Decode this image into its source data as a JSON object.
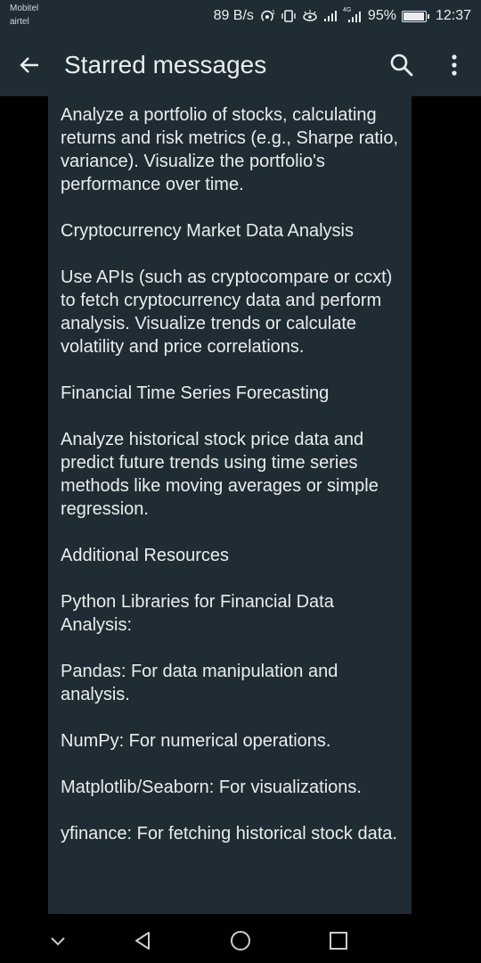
{
  "status_bar": {
    "carrier_1": "Mobitel",
    "carrier_2": "airtel",
    "network_speed": "89 B/s",
    "network_type": "4G",
    "battery_percent": "95%",
    "battery_level": 0.95,
    "time": "12:37",
    "icons": [
      "hotspot-icon",
      "vibrate-icon",
      "eye-comfort-icon",
      "signal-icon",
      "signal-4g-icon",
      "battery-icon"
    ]
  },
  "app_bar": {
    "title": "Starred messages",
    "icons": [
      "back-arrow-icon",
      "search-icon",
      "more-vert-icon"
    ]
  },
  "message": {
    "paragraphs": [
      "Analyze a portfolio of stocks, calculating returns and risk metrics (e.g., Sharpe ratio, variance). Visualize the portfolio's performance over time.",
      "Cryptocurrency Market Data Analysis",
      "Use APIs (such as cryptocompare or ccxt) to fetch cryptocurrency data and perform analysis. Visualize trends or calculate volatility and price correlations.",
      "Financial Time Series Forecasting",
      "Analyze historical stock price data and predict future trends using time series methods like moving averages or simple regression.",
      "Additional Resources",
      "Python Libraries for Financial Data Analysis:",
      "Pandas: For data manipulation and analysis.",
      "NumPy: For numerical operations.",
      "Matplotlib/Seaborn: For visualizations.",
      "yfinance: For fetching historical stock data."
    ]
  },
  "nav_bar": {
    "icons": [
      "chevron-down-icon",
      "back-triangle-icon",
      "home-circle-icon",
      "recents-square-icon"
    ]
  },
  "colors": {
    "app_bar": "#1f2c34",
    "bubble": "#202c33",
    "text": "#e9edef",
    "background": "#000000"
  }
}
